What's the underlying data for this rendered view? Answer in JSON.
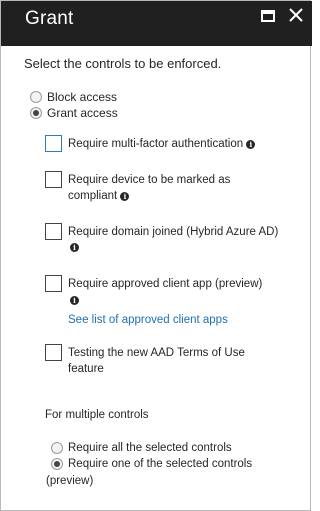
{
  "header": {
    "title": "Grant"
  },
  "instruction": "Select the controls to be enforced.",
  "access_options": [
    {
      "label": "Block access",
      "selected": false
    },
    {
      "label": "Grant access",
      "selected": true
    }
  ],
  "controls": [
    {
      "line1": "Require multi-factor authentication",
      "info": true
    },
    {
      "line1": "Require device to be marked as",
      "line2": "compliant",
      "info": true
    },
    {
      "line1": "Require domain joined (Hybrid Azure AD)",
      "info": true
    },
    {
      "line1": "Require approved client app (preview)",
      "info": true
    },
    {
      "line1": "Testing the new AAD Terms of Use",
      "line2": "feature"
    }
  ],
  "approved_apps_link": "See list of approved client apps",
  "multiple_controls": {
    "label": "For multiple controls",
    "options": [
      {
        "label": "Require all the selected controls",
        "selected": false
      },
      {
        "label": "Require one of the selected controls",
        "continuation": "(preview)",
        "selected": true
      }
    ]
  },
  "icons": {
    "maximize": "maximize-icon",
    "close": "close-icon",
    "info": "info-icon"
  },
  "colors": {
    "titlebar": "#202020",
    "link": "#1f6fb5",
    "focus": "#2e7cc0"
  }
}
